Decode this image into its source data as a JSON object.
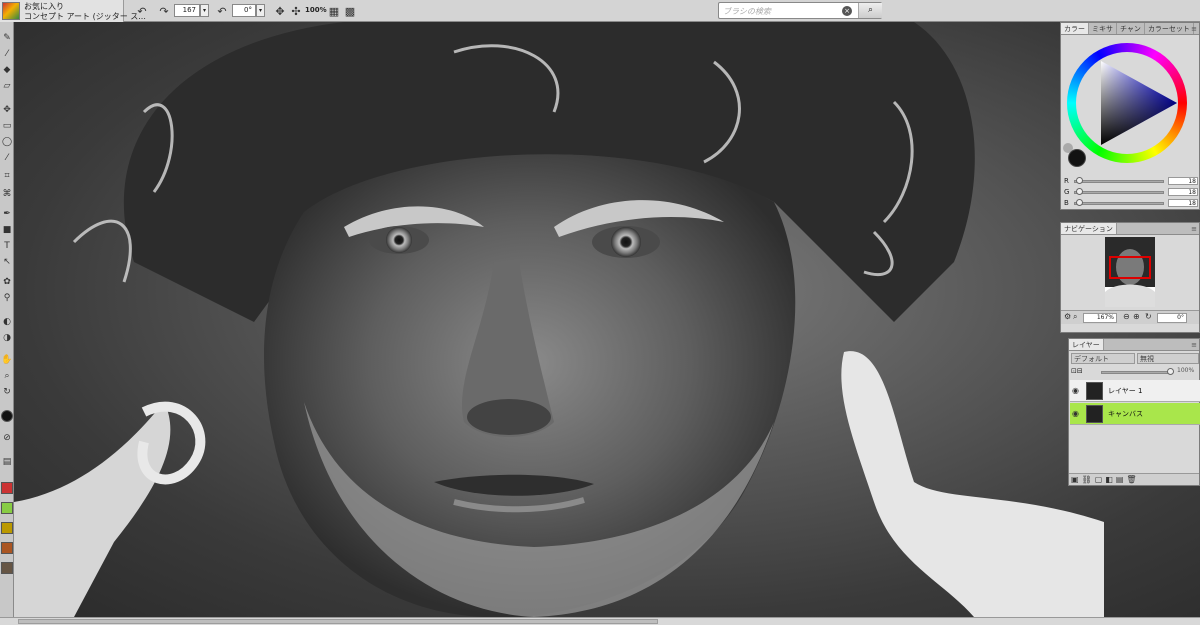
{
  "toolbar": {
    "favorites_line1": "お気に入り",
    "favorites_line2": "コンセプト アート (ジッター ス...",
    "rotation_a": "167",
    "rotation_b": "0°",
    "zoom_label": "100%",
    "search_placeholder": "ブラシの検索",
    "search_clear": "⊗",
    "search_go": "🔍"
  },
  "color_palette": {
    "tabs": [
      "カラー",
      "ミキサ",
      "チャン",
      "カラーセット"
    ],
    "r_label": "R",
    "r_value": "18",
    "g_label": "G",
    "g_value": "18",
    "b_label": "B",
    "b_value": "18",
    "main_color": "#121212"
  },
  "navigator": {
    "title": "ナビゲーション",
    "zoom": "167%",
    "rotation": "0°"
  },
  "layers": {
    "title": "レイヤー",
    "composite_method": "デフォルト",
    "blend_mode": "無視",
    "opacity": "100%",
    "items": [
      {
        "name": "レイヤー 1",
        "selected": false
      },
      {
        "name": "キャンバス",
        "selected": true
      }
    ]
  }
}
